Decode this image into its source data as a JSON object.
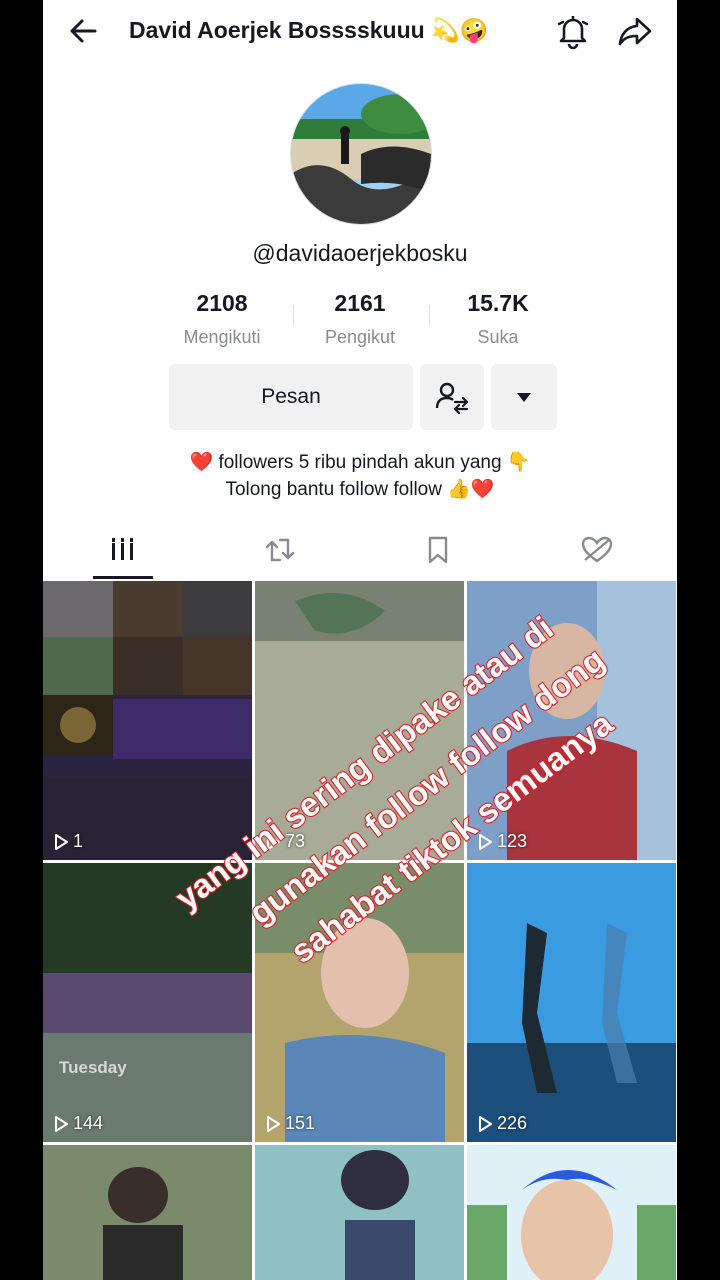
{
  "header": {
    "title": "David Aoerjek Bosssskuuu 💫🤪",
    "back_icon": "back-arrow-icon",
    "bell_icon": "bell-icon",
    "share_icon": "share-icon"
  },
  "profile": {
    "handle": "@davidaoerjekbosku",
    "stats": [
      {
        "value": "2108",
        "label": "Mengikuti"
      },
      {
        "value": "2161",
        "label": "Pengikut"
      },
      {
        "value": "15.7K",
        "label": "Suka"
      }
    ],
    "message_button": "Pesan",
    "bio_line1": "❤️ followers 5 ribu pindah akun yang 👇",
    "bio_line2": "Tolong bantu follow follow 👍❤️"
  },
  "tabs": [
    "videos-grid-icon",
    "repost-icon",
    "bookmark-icon",
    "liked-icon"
  ],
  "videos": [
    {
      "views": "1"
    },
    {
      "views": "73"
    },
    {
      "views": "123"
    },
    {
      "views": "144"
    },
    {
      "views": "151"
    },
    {
      "views": "226"
    },
    {
      "views": ""
    },
    {
      "views": ""
    },
    {
      "views": ""
    }
  ],
  "overlay_text": {
    "line1": "yang ini sering dipake atau di",
    "line2": "gunakan follow follow dong",
    "line3": "sahabat tiktok semuanya"
  },
  "colors": {
    "overlay_stroke": "#d72128",
    "text_primary": "#161823",
    "text_secondary": "#8a8b91"
  }
}
